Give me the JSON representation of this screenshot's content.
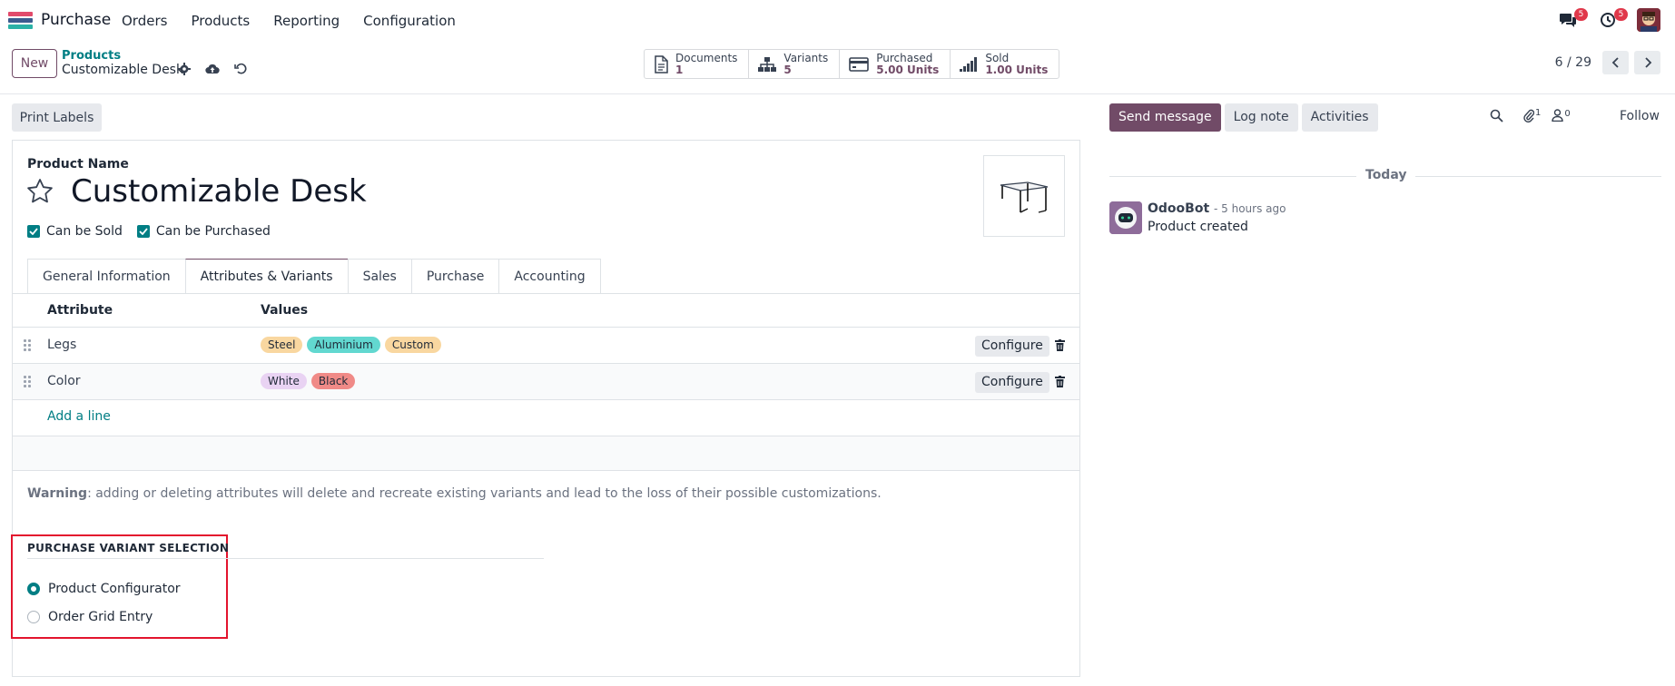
{
  "topnav": {
    "app_name": "Purchase",
    "menu": [
      "Orders",
      "Products",
      "Reporting",
      "Configuration"
    ],
    "messages_badge": "5",
    "activities_badge": "5"
  },
  "control": {
    "new_label": "New",
    "breadcrumb_parent": "Products",
    "breadcrumb_current": "Customizable Desk",
    "pager": "6 / 29"
  },
  "stats": [
    {
      "label": "Documents",
      "value": "1",
      "icon": "document-icon"
    },
    {
      "label": "Variants",
      "value": "5",
      "icon": "sitemap-icon"
    },
    {
      "label": "Purchased",
      "value": "5.00 Units",
      "icon": "credit-card-icon"
    },
    {
      "label": "Sold",
      "value": "1.00 Units",
      "icon": "signal-icon"
    }
  ],
  "form": {
    "print_labels": "Print Labels",
    "product_name_label": "Product Name",
    "product_name": "Customizable Desk",
    "can_be_sold": "Can be Sold",
    "can_be_purchased": "Can be Purchased",
    "tabs": [
      "General Information",
      "Attributes & Variants",
      "Sales",
      "Purchase",
      "Accounting"
    ],
    "active_tab": "Attributes & Variants",
    "table_headers": {
      "attribute": "Attribute",
      "values": "Values"
    },
    "rows": [
      {
        "attribute": "Legs",
        "values": [
          {
            "label": "Steel",
            "color": "#f9d7a0"
          },
          {
            "label": "Aluminium",
            "color": "#62d8d0"
          },
          {
            "label": "Custom",
            "color": "#f9d7a0"
          }
        ],
        "configure": "Configure"
      },
      {
        "attribute": "Color",
        "values": [
          {
            "label": "White",
            "color": "#e9d3f3"
          },
          {
            "label": "Black",
            "color": "#f08a87"
          }
        ],
        "configure": "Configure"
      }
    ],
    "add_line": "Add a line",
    "warning_bold": "Warning",
    "warning_text": ": adding or deleting attributes will delete and recreate existing variants and lead to the loss of their possible customizations.",
    "pvs_title": "PURCHASE VARIANT SELECTION",
    "pvs_options": [
      "Product Configurator",
      "Order Grid Entry"
    ],
    "pvs_selected": "Product Configurator"
  },
  "chatter": {
    "send_message": "Send message",
    "log_note": "Log note",
    "activities": "Activities",
    "attachments_count": "1",
    "followers_count": "0",
    "follow": "Follow",
    "today": "Today",
    "message": {
      "author": "OdooBot",
      "time": "- 5 hours ago",
      "body": "Product created"
    }
  },
  "colors": {
    "brand": "#714b67",
    "accent": "#017e84",
    "highlight_box": "#e3142d"
  }
}
